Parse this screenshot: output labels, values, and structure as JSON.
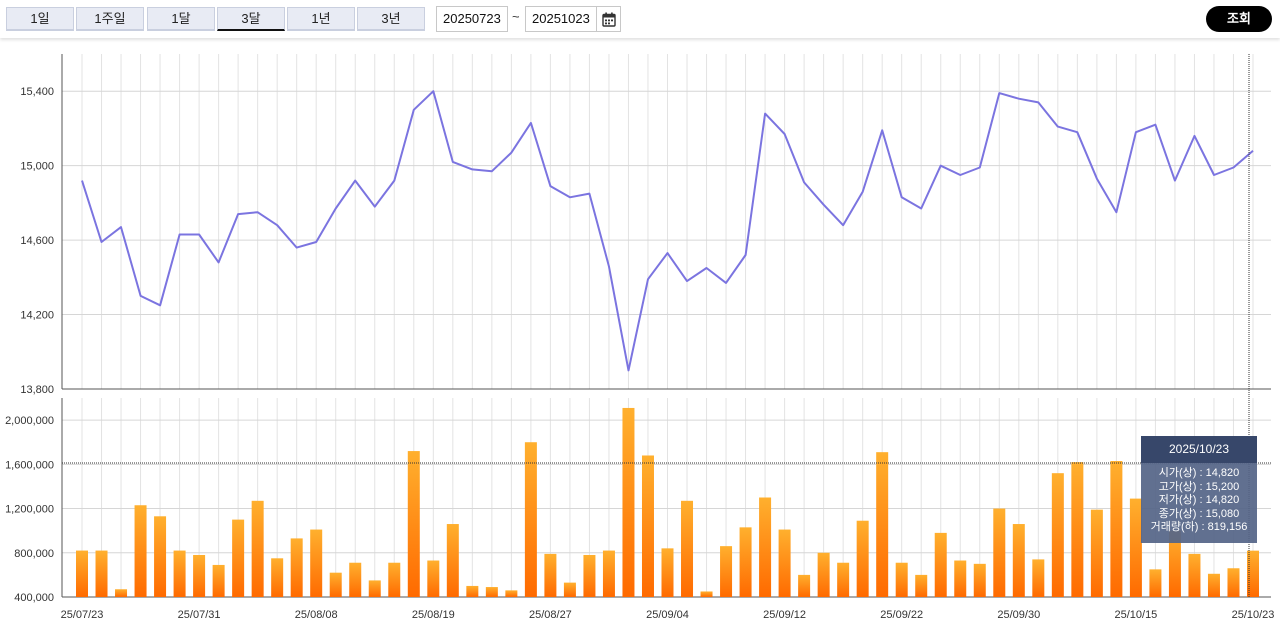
{
  "toolbar": {
    "periods": [
      "1일",
      "1주일",
      "1달",
      "3달",
      "1년",
      "3년"
    ],
    "active_period": "3달",
    "start_date": "20250723",
    "end_date": "20251023",
    "separator": "~",
    "search_label": "조회"
  },
  "tooltip": {
    "date": "2025/10/23",
    "lines": [
      {
        "label": "시가(상)",
        "value": "14,820"
      },
      {
        "label": "고가(상)",
        "value": "15,200"
      },
      {
        "label": "저가(상)",
        "value": "14,820"
      },
      {
        "label": "종가(상)",
        "value": "15,080"
      },
      {
        "label": "거래량(하)",
        "value": "819,156"
      }
    ]
  },
  "colors": {
    "price_line": "#7b74e0",
    "volume_top": "#ffb02e",
    "volume_bottom": "#ff6a00",
    "grid": "#dedede",
    "tooltip_head": "#37476a"
  },
  "chart_data": [
    {
      "type": "line",
      "name": "price",
      "ylim": [
        13800,
        15600
      ],
      "yticks": [
        "15,400",
        "15,000",
        "14,600",
        "14,200",
        "13,800"
      ],
      "ytick_values": [
        15400,
        15000,
        14600,
        14200,
        13800
      ],
      "x": [
        "2025-07-23",
        "2025-07-24",
        "2025-07-25",
        "2025-07-28",
        "2025-07-29",
        "2025-07-30",
        "2025-07-31",
        "2025-08-01",
        "2025-08-04",
        "2025-08-05",
        "2025-08-06",
        "2025-08-07",
        "2025-08-08",
        "2025-08-11",
        "2025-08-12",
        "2025-08-13",
        "2025-08-14",
        "2025-08-18",
        "2025-08-19",
        "2025-08-20",
        "2025-08-21",
        "2025-08-22",
        "2025-08-25",
        "2025-08-26",
        "2025-08-27",
        "2025-08-28",
        "2025-08-29",
        "2025-09-01",
        "2025-09-02",
        "2025-09-03",
        "2025-09-04",
        "2025-09-05",
        "2025-09-08",
        "2025-09-09",
        "2025-09-10",
        "2025-09-11",
        "2025-09-12",
        "2025-09-15",
        "2025-09-16",
        "2025-09-17",
        "2025-09-18",
        "2025-09-19",
        "2025-09-22",
        "2025-09-23",
        "2025-09-24",
        "2025-09-25",
        "2025-09-26",
        "2025-09-29",
        "2025-09-30",
        "2025-10-01",
        "2025-10-02",
        "2025-10-10",
        "2025-10-13",
        "2025-10-14",
        "2025-10-15",
        "2025-10-16",
        "2025-10-17",
        "2025-10-20",
        "2025-10-21",
        "2025-10-22",
        "2025-10-23"
      ],
      "values": [
        14920,
        14590,
        14670,
        14300,
        14250,
        14630,
        14630,
        14480,
        14740,
        14750,
        14680,
        14560,
        14590,
        14770,
        14920,
        14780,
        14920,
        15300,
        15400,
        15020,
        14980,
        14970,
        15070,
        15230,
        14890,
        14830,
        14850,
        14460,
        13900,
        14390,
        14530,
        14380,
        14450,
        14370,
        14520,
        15280,
        15170,
        14910,
        14790,
        14680,
        14860,
        15190,
        14830,
        14770,
        15000,
        14950,
        14990,
        15390,
        15360,
        15340,
        15210,
        15180,
        14930,
        14750,
        15180,
        15220,
        14920,
        15160,
        14950,
        14990,
        15080
      ]
    },
    {
      "type": "bar",
      "name": "volume",
      "ylim": [
        400000,
        2200000
      ],
      "yticks": [
        "2,000,000",
        "1,600,000",
        "1,200,000",
        "800,000",
        "400,000"
      ],
      "ytick_values": [
        2000000,
        1600000,
        1200000,
        800000,
        400000
      ],
      "xtick_labels": [
        "25/07/23",
        "25/07/31",
        "25/08/08",
        "25/08/19",
        "25/08/27",
        "25/09/04",
        "25/09/12",
        "25/09/22",
        "25/09/30",
        "25/10/15",
        "25/10/23"
      ],
      "values": [
        820000,
        820000,
        470000,
        1230000,
        1130000,
        820000,
        780000,
        690000,
        1100000,
        1270000,
        750000,
        930000,
        1010000,
        620000,
        710000,
        550000,
        710000,
        1720000,
        730000,
        1060000,
        500000,
        490000,
        460000,
        1800000,
        790000,
        530000,
        780000,
        820000,
        2110000,
        1680000,
        840000,
        1270000,
        450000,
        860000,
        1030000,
        1300000,
        1010000,
        600000,
        800000,
        710000,
        1090000,
        1710000,
        710000,
        600000,
        980000,
        730000,
        700000,
        1200000,
        1060000,
        740000,
        1520000,
        1620000,
        1190000,
        1630000,
        1290000,
        650000,
        1000000,
        790000,
        610000,
        660000,
        819156
      ]
    }
  ]
}
